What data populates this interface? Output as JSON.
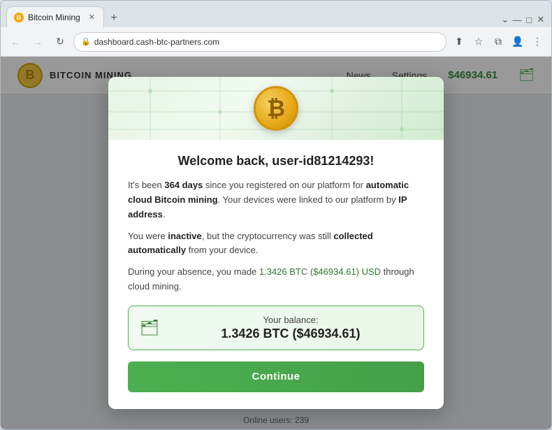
{
  "browser": {
    "tab_title": "Bitcoin Mining",
    "tab_favicon": "B",
    "new_tab_symbol": "+",
    "collapse_symbol": "⌄",
    "minimize_symbol": "—",
    "maximize_symbol": "□",
    "close_symbol": "✕",
    "back_symbol": "←",
    "forward_symbol": "→",
    "refresh_symbol": "↻",
    "address": "dashboard.cash-btc-partners.com",
    "lock_symbol": "🔒",
    "share_symbol": "⬆",
    "star_symbol": "☆",
    "split_symbol": "⧉",
    "profile_symbol": "👤",
    "menu_symbol": "⋮"
  },
  "app_header": {
    "logo_letter": "B",
    "logo_text": "BITCOIN MINING",
    "nav_items": [
      "News",
      "Settings"
    ],
    "balance": "$46934.61",
    "wallet_symbol": "🗂"
  },
  "modal": {
    "coin_symbol": "₿",
    "title": "Welcome back, user-id81214293!",
    "paragraph1_pre": "It's been ",
    "paragraph1_bold1": "364 days",
    "paragraph1_mid": " since you registered on our platform for ",
    "paragraph1_bold2": "automatic cloud Bitcoin mining",
    "paragraph1_end": ". Your devices were linked to our platform by ",
    "paragraph1_bold3": "IP address",
    "paragraph1_period": ".",
    "paragraph2_pre": "You were ",
    "paragraph2_bold1": "inactive",
    "paragraph2_mid": ", but the cryptocurrency was still ",
    "paragraph2_bold2": "collected automatically",
    "paragraph2_end": " from your device.",
    "paragraph3_pre": "During your absence, you made ",
    "paragraph3_highlight": "1.3426 BTC ($46934.61) USD",
    "paragraph3_end": " through cloud mining.",
    "balance_label": "Your balance:",
    "balance_amount": "1.3426 BTC ($46934.61)",
    "continue_label": "Continue"
  },
  "footer": {
    "label": "Online users:",
    "count": "239"
  }
}
